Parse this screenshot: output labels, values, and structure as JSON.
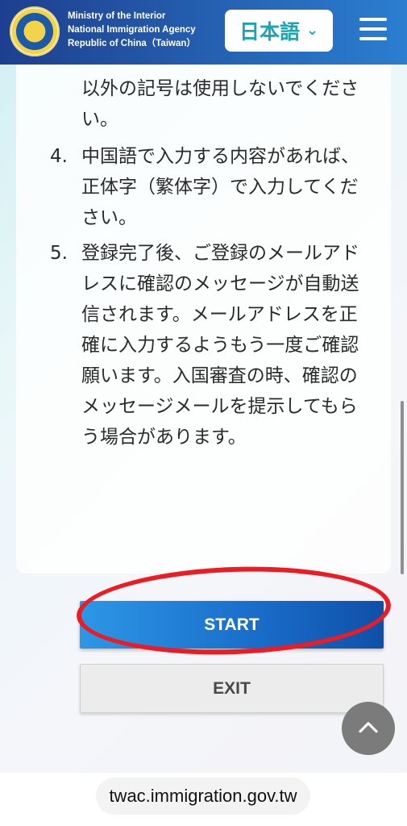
{
  "header": {
    "agency_lines": [
      "Ministry of the Interior",
      "National Immigration Agency",
      "Republic of China（Taiwan）"
    ],
    "language_label": "日本語"
  },
  "content": {
    "fragment": "以外の記号は使用しないでください。",
    "items": [
      {
        "number": "4.",
        "text": "中国語で入力する内容があれば、正体字（繁体字）で入力してください。"
      },
      {
        "number": "5.",
        "text": "登録完了後、ご登録のメールアドレスに確認のメッセージが自動送信されます。メールアドレスを正確に入力するようもう一度ご確認願います。入国審査の時、確認のメッセージメールを提示してもらう場合があります。"
      }
    ]
  },
  "buttons": {
    "start_label": "START",
    "exit_label": "EXIT"
  },
  "footer": {
    "url": "twac.immigration.gov.tw"
  },
  "colors": {
    "header_gradient_start": "#1e3f8f",
    "header_gradient_end": "#2b7ed0",
    "language_text": "#18a6b6",
    "start_button": "#1a6fcb",
    "highlight_oval": "#ea1c24"
  }
}
